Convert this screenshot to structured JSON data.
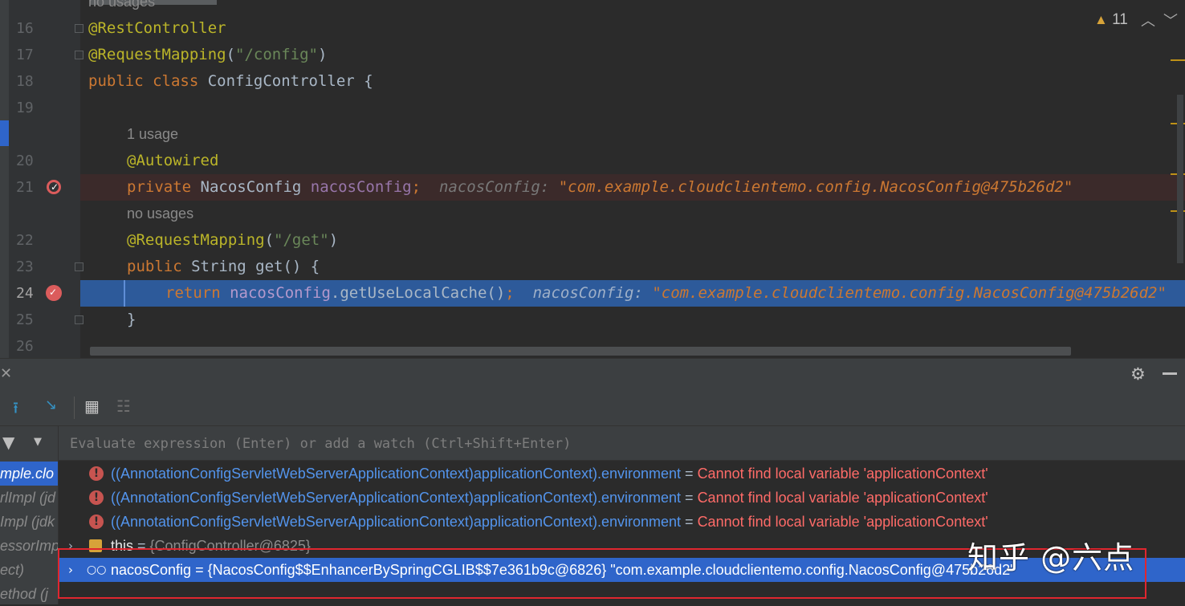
{
  "editor": {
    "top_hint": "no usages",
    "line_numbers": [
      "16",
      "17",
      "18",
      "19",
      "20",
      "21",
      "22",
      "23",
      "24",
      "25",
      "26"
    ],
    "line16": {
      "annotation": "@RestController"
    },
    "line17": {
      "annotation": "@RequestMapping",
      "paren_open": "(",
      "string": "\"/config\"",
      "paren_close": ")"
    },
    "line18": {
      "kw": "public class ",
      "name": "ConfigController",
      "brace": " {"
    },
    "usage_hint_1": "1 usage",
    "line20": {
      "annotation": "@Autowired"
    },
    "line21": {
      "kw": "private ",
      "type": "NacosConfig ",
      "field": "nacosConfig",
      "semi": ";",
      "inline_label": "nacosConfig: ",
      "inline_value": "\"com.example.cloudclientemo.config.NacosConfig@475b26d2\""
    },
    "usage_hint_2": "no usages",
    "line22": {
      "annotation": "@RequestMapping",
      "paren_open": "(",
      "string": "\"/get\"",
      "paren_close": ")"
    },
    "line23": {
      "kw": "public ",
      "type": "String ",
      "method": "get",
      "rest": "() {"
    },
    "line24": {
      "kw": "return ",
      "field": "nacosConfig",
      "call": ".getUseLocalCache()",
      "semi": ";",
      "inline_label": "nacosConfig: ",
      "inline_value": "\"com.example.cloudclientemo.config.NacosConfig@475b26d2\""
    },
    "line25": {
      "brace": "}"
    },
    "warnings_count": "11"
  },
  "debug": {
    "watch_placeholder": "Evaluate expression (Enter) or add a watch (Ctrl+Shift+Enter)",
    "frames": [
      "mple.clo",
      "rlImpl (jd",
      "Impl (jdk",
      "essorImp",
      "ect)",
      "ethod (j"
    ],
    "watches": [
      {
        "expr": "((AnnotationConfigServletWebServerApplicationContext)applicationContext).environment",
        "eq": " = ",
        "error": "Cannot find local variable 'applicationContext'"
      },
      {
        "expr": "((AnnotationConfigServletWebServerApplicationContext)applicationContext).environment",
        "eq": " = ",
        "error": "Cannot find local variable 'applicationContext'"
      },
      {
        "expr": "((AnnotationConfigServletWebServerApplicationContext)applicationContext).environment",
        "eq": " = ",
        "error": "Cannot find local variable 'applicationContext'"
      }
    ],
    "this_row": {
      "name": "this",
      "eq": " = ",
      "value": "{ConfigController@6825}"
    },
    "nacos_row": {
      "name": "nacosConfig",
      "eq": " = ",
      "value": "{NacosConfig$$EnhancerBySpringCGLIB$$7e361b9c@6826} ",
      "string": "\"com.example.cloudclientemo.config.NacosConfig@475b26d2\""
    }
  },
  "watermark": "知乎 @六点",
  "icons": {
    "warning": "warning-triangle-icon",
    "gear": "gear-icon",
    "calculator": "evaluate-expression-icon",
    "filter": "filter-icon",
    "glasses": "watch-glasses-icon"
  },
  "colors": {
    "breakpoint": "#db5c5c",
    "execution_line": "#2d5a9a",
    "selection": "#2f65ca",
    "error_text": "#ff6b68",
    "link_text": "#5394ec",
    "redbox": "#e0262f"
  }
}
